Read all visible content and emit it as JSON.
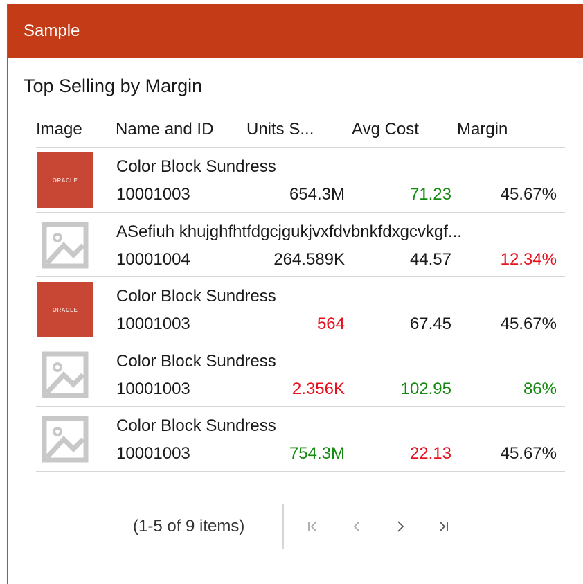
{
  "panel": {
    "header_title": "Sample",
    "list_title": "Top Selling by Margin"
  },
  "columns": {
    "image": "Image",
    "name": "Name and ID",
    "units": "Units S...",
    "cost": "Avg Cost",
    "margin": "Margin"
  },
  "rows": [
    {
      "image": "oracle-logo",
      "name": "Color Block Sundress",
      "id": "10001003",
      "units": "654.3M",
      "units_status": "neutral",
      "cost": "71.23",
      "cost_status": "green",
      "margin": "45.67%",
      "margin_status": "neutral"
    },
    {
      "image": "image-placeholder-icon",
      "name": "ASefiuh khujghfhtfdgcjgukjvxfdvbnkfdxgcvkgf...",
      "id": "10001004",
      "units": "264.589K",
      "units_status": "neutral",
      "cost": "44.57",
      "cost_status": "neutral",
      "margin": "12.34%",
      "margin_status": "red"
    },
    {
      "image": "oracle-logo",
      "name": "Color Block Sundress",
      "id": "10001003",
      "units": "564",
      "units_status": "red",
      "cost": "67.45",
      "cost_status": "neutral",
      "margin": "45.67%",
      "margin_status": "neutral"
    },
    {
      "image": "image-placeholder-icon",
      "name": "Color Block Sundress",
      "id": "10001003",
      "units": "2.356K",
      "units_status": "red",
      "cost": "102.95",
      "cost_status": "green",
      "margin": "86%",
      "margin_status": "green"
    },
    {
      "image": "image-placeholder-icon",
      "name": "Color Block Sundress",
      "id": "10001003",
      "units": "754.3M",
      "units_status": "green",
      "cost": "22.13",
      "cost_status": "red",
      "margin": "45.67%",
      "margin_status": "neutral"
    }
  ],
  "logo_text": "ORACLE",
  "pagination": {
    "status": "(1-5 of 9 items)",
    "buttons": [
      "first-page-icon",
      "previous-page-icon",
      "next-page-icon",
      "last-page-icon"
    ]
  },
  "colors": {
    "header": "#c43c17",
    "oracle_red": "#c74634",
    "green": "#138a0f",
    "red": "#e8101d"
  }
}
